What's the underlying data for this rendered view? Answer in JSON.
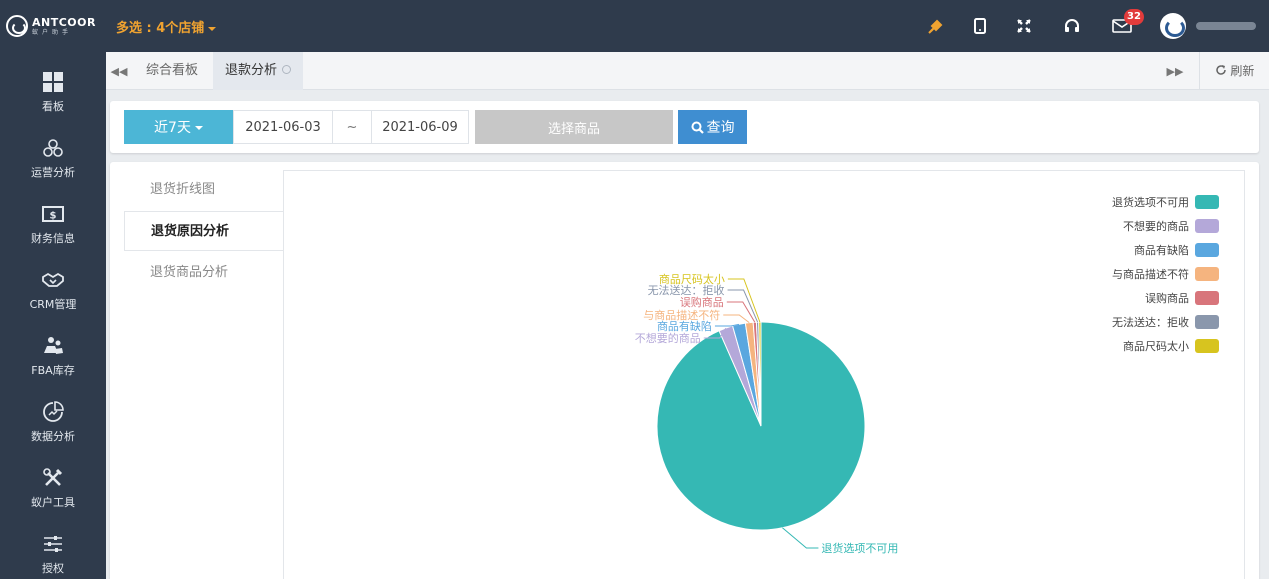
{
  "app": {
    "logo_text": "ANTCOOR",
    "logo_sub": "蚁户助手",
    "store_select": "多选 : 4个店铺",
    "notification_count": "32"
  },
  "sidebar": {
    "items": [
      {
        "label": "看板",
        "icon": "dashboard-icon"
      },
      {
        "label": "运营分析",
        "icon": "operations-icon"
      },
      {
        "label": "财务信息",
        "icon": "finance-icon"
      },
      {
        "label": "CRM管理",
        "icon": "handshake-icon"
      },
      {
        "label": "FBA库存",
        "icon": "inventory-icon"
      },
      {
        "label": "数据分析",
        "icon": "pie-analysis-icon"
      },
      {
        "label": "蚁户工具",
        "icon": "tools-icon"
      },
      {
        "label": "授权",
        "icon": "sliders-icon"
      }
    ]
  },
  "tabs": {
    "items": [
      {
        "label": "综合看板"
      },
      {
        "label": "退款分析"
      }
    ],
    "refresh_label": "刷新"
  },
  "filter": {
    "range_label": "近7天",
    "start_date": "2021-06-03",
    "separator": "~",
    "end_date": "2021-06-09",
    "product_label": "选择商品",
    "query_label": "查询"
  },
  "analysis_tabs": [
    {
      "label": "退货折线图"
    },
    {
      "label": "退货原因分析"
    },
    {
      "label": "退货商品分析"
    }
  ],
  "chart_data": {
    "type": "pie",
    "legend_position": "top-right",
    "slices": [
      {
        "name": "退货选项不可用",
        "value": 93.4,
        "color": "#35b8b4"
      },
      {
        "name": "不想要的商品",
        "value": 2.2,
        "color": "#b4a8d9"
      },
      {
        "name": "商品有缺陷",
        "value": 2.0,
        "color": "#5aa7df"
      },
      {
        "name": "与商品描述不符",
        "value": 1.2,
        "color": "#f5b47f"
      },
      {
        "name": "误购商品",
        "value": 0.5,
        "color": "#d8757b"
      },
      {
        "name": "无法送达：拒收",
        "value": 0.35,
        "color": "#8a97ac"
      },
      {
        "name": "商品尺码太小",
        "value": 0.35,
        "color": "#d7c41f"
      }
    ]
  }
}
